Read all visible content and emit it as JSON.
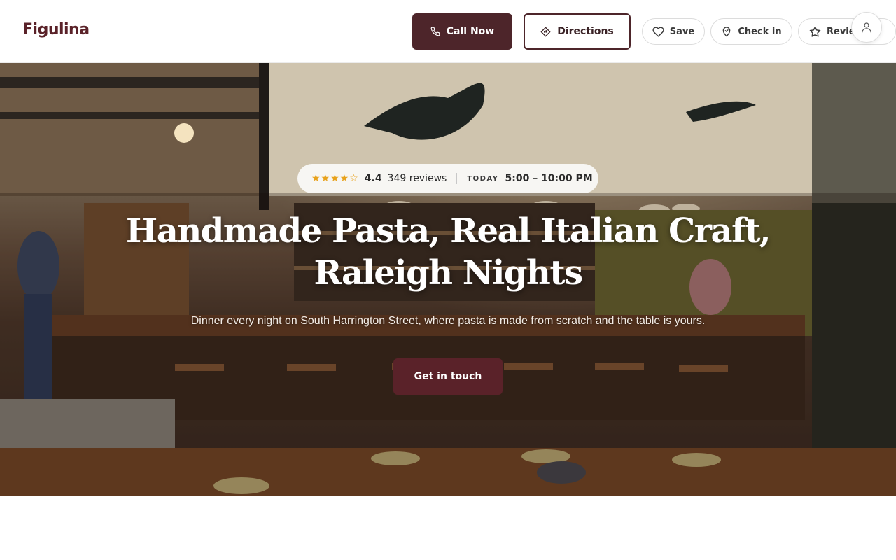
{
  "brand": {
    "name": "Figulina",
    "color": "#5a2229"
  },
  "header": {
    "call_label": "Call Now",
    "directions_label": "Directions",
    "save_label": "Save",
    "checkin_label": "Check in",
    "review_label": "Review"
  },
  "hero": {
    "stars": "★★★★☆",
    "rating": "4.4",
    "review_count": "349 reviews",
    "today_label": "TODAY",
    "hours": "5:00 – 10:00 PM",
    "headline_line1": "Handmade Pasta, Real Italian Craft,",
    "headline_line2": "Raleigh Nights",
    "subheadline": "Dinner every night on South Harrington Street, where pasta is made from scratch and the table is yours.",
    "cta_label": "Get in touch"
  },
  "icons": {
    "call": "phone-icon",
    "directions": "directions-icon",
    "save": "heart-icon",
    "checkin": "map-pin-icon",
    "review": "star-icon",
    "account": "user-icon"
  },
  "colors": {
    "accent": "#4d252a",
    "star": "#e8a21c"
  }
}
